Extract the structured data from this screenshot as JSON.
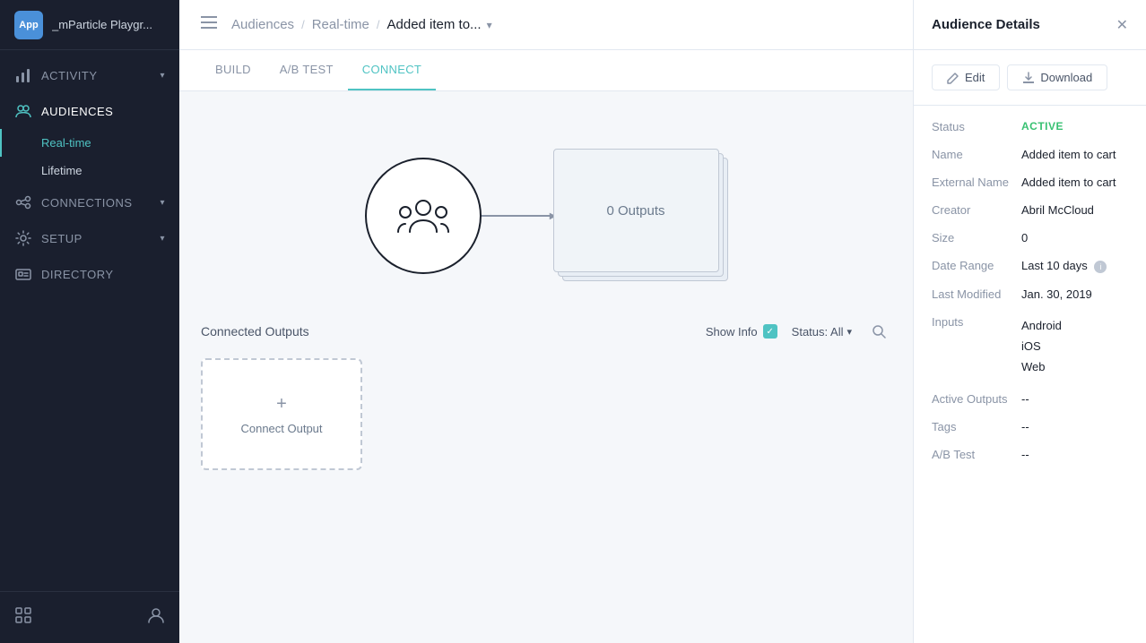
{
  "app": {
    "icon_label": "App",
    "name": "_mParticle Playgr..."
  },
  "sidebar": {
    "nav_items": [
      {
        "id": "activity",
        "label": "ACTIVITY",
        "icon": "chart-icon",
        "has_chevron": true,
        "active": false
      },
      {
        "id": "audiences",
        "label": "AUDIENCES",
        "icon": "audience-icon",
        "has_chevron": false,
        "active": true
      },
      {
        "id": "connections",
        "label": "CONNECTIONS",
        "icon": "connection-icon",
        "has_chevron": true,
        "active": false
      },
      {
        "id": "setup",
        "label": "SETUP",
        "icon": "setup-icon",
        "has_chevron": true,
        "active": false
      },
      {
        "id": "directory",
        "label": "DIRECTORY",
        "icon": "directory-icon",
        "has_chevron": false,
        "active": false
      }
    ],
    "sub_items": [
      {
        "id": "realtime",
        "label": "Real-time",
        "active": true
      },
      {
        "id": "lifetime",
        "label": "Lifetime",
        "active": false
      }
    ],
    "footer_icons": [
      "grid-icon",
      "user-icon"
    ]
  },
  "topbar": {
    "menu_icon": "≡",
    "breadcrumb": [
      {
        "label": "Audiences",
        "active": false
      },
      {
        "label": "Real-time",
        "active": false
      },
      {
        "label": "Added item to...",
        "active": true
      }
    ],
    "breadcrumb_chevron": "▾"
  },
  "tabs": [
    {
      "id": "build",
      "label": "BUILD",
      "active": false
    },
    {
      "id": "ab_test",
      "label": "A/B TEST",
      "active": false
    },
    {
      "id": "connect",
      "label": "CONNECT",
      "active": true
    }
  ],
  "diagram": {
    "outputs_label": "0 Outputs"
  },
  "connected_outputs": {
    "title": "Connected Outputs",
    "show_info_label": "Show Info",
    "status_label": "Status: All",
    "connect_output_label": "Connect Output"
  },
  "panel": {
    "title": "Audience Details",
    "edit_label": "Edit",
    "download_label": "Download",
    "details": [
      {
        "label": "Status",
        "value": "ACTIVE",
        "type": "status"
      },
      {
        "label": "Name",
        "value": "Added item to cart",
        "type": "text"
      },
      {
        "label": "External Name",
        "value": "Added item to cart",
        "type": "text"
      },
      {
        "label": "Creator",
        "value": "Abril McCloud",
        "type": "text"
      },
      {
        "label": "Size",
        "value": "0",
        "type": "text"
      },
      {
        "label": "Date Range",
        "value": "Last 10 days",
        "type": "text_with_info"
      },
      {
        "label": "Last Modified",
        "value": "Jan. 30, 2019",
        "type": "text"
      },
      {
        "label": "Inputs",
        "value": "Android\niOS\nWeb",
        "type": "multiline"
      },
      {
        "label": "Active Outputs",
        "value": "--",
        "type": "text"
      },
      {
        "label": "Tags",
        "value": "--",
        "type": "text"
      },
      {
        "label": "A/B Test",
        "value": "--",
        "type": "text"
      }
    ]
  }
}
